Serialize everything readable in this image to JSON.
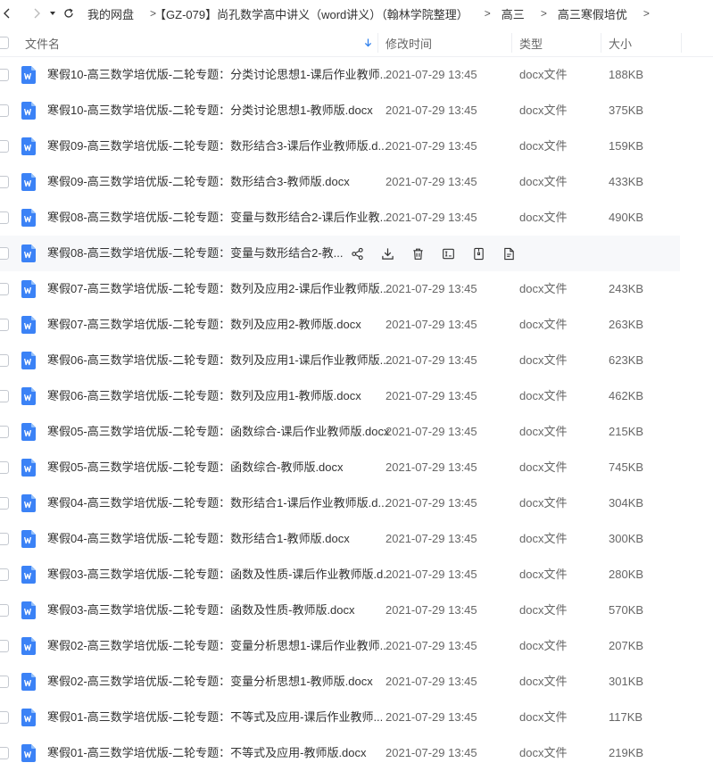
{
  "breadcrumb": [
    "我的网盘",
    "【GZ-079】尚孔数学高中讲义（word讲义）（翰林学院整理）",
    "高三",
    "高三寒假培优"
  ],
  "header": {
    "name": "文件名",
    "date": "修改时间",
    "type": "类型",
    "size": "大小"
  },
  "files": [
    {
      "name": "寒假10-高三数学培优版-二轮专题：分类讨论思想1-课后作业教师...",
      "date": "2021-07-29 13:45",
      "type": "docx文件",
      "size": "188KB"
    },
    {
      "name": "寒假10-高三数学培优版-二轮专题：分类讨论思想1-教师版.docx",
      "date": "2021-07-29 13:45",
      "type": "docx文件",
      "size": "375KB"
    },
    {
      "name": "寒假09-高三数学培优版-二轮专题：数形结合3-课后作业教师版.d...",
      "date": "2021-07-29 13:45",
      "type": "docx文件",
      "size": "159KB"
    },
    {
      "name": "寒假09-高三数学培优版-二轮专题：数形结合3-教师版.docx",
      "date": "2021-07-29 13:45",
      "type": "docx文件",
      "size": "433KB"
    },
    {
      "name": "寒假08-高三数学培优版-二轮专题：变量与数形结合2-课后作业教...",
      "date": "2021-07-29 13:45",
      "type": "docx文件",
      "size": "490KB"
    },
    {
      "name": "寒假08-高三数学培优版-二轮专题：变量与数形结合2-教...",
      "date": "",
      "type": "",
      "size": "",
      "hover": true
    },
    {
      "name": "寒假07-高三数学培优版-二轮专题：数列及应用2-课后作业教师版....",
      "date": "2021-07-29 13:45",
      "type": "docx文件",
      "size": "243KB"
    },
    {
      "name": "寒假07-高三数学培优版-二轮专题：数列及应用2-教师版.docx",
      "date": "2021-07-29 13:45",
      "type": "docx文件",
      "size": "263KB"
    },
    {
      "name": "寒假06-高三数学培优版-二轮专题：数列及应用1-课后作业教师版....",
      "date": "2021-07-29 13:45",
      "type": "docx文件",
      "size": "623KB"
    },
    {
      "name": "寒假06-高三数学培优版-二轮专题：数列及应用1-教师版.docx",
      "date": "2021-07-29 13:45",
      "type": "docx文件",
      "size": "462KB"
    },
    {
      "name": "寒假05-高三数学培优版-二轮专题：函数综合-课后作业教师版.docx",
      "date": "2021-07-29 13:45",
      "type": "docx文件",
      "size": "215KB"
    },
    {
      "name": "寒假05-高三数学培优版-二轮专题：函数综合-教师版.docx",
      "date": "2021-07-29 13:45",
      "type": "docx文件",
      "size": "745KB"
    },
    {
      "name": "寒假04-高三数学培优版-二轮专题：数形结合1-课后作业教师版.d...",
      "date": "2021-07-29 13:45",
      "type": "docx文件",
      "size": "304KB"
    },
    {
      "name": "寒假04-高三数学培优版-二轮专题：数形结合1-教师版.docx",
      "date": "2021-07-29 13:45",
      "type": "docx文件",
      "size": "300KB"
    },
    {
      "name": "寒假03-高三数学培优版-二轮专题：函数及性质-课后作业教师版.d...",
      "date": "2021-07-29 13:45",
      "type": "docx文件",
      "size": "280KB"
    },
    {
      "name": "寒假03-高三数学培优版-二轮专题：函数及性质-教师版.docx",
      "date": "2021-07-29 13:45",
      "type": "docx文件",
      "size": "570KB"
    },
    {
      "name": "寒假02-高三数学培优版-二轮专题：变量分析思想1-课后作业教师...",
      "date": "2021-07-29 13:45",
      "type": "docx文件",
      "size": "207KB"
    },
    {
      "name": "寒假02-高三数学培优版-二轮专题：变量分析思想1-教师版.docx",
      "date": "2021-07-29 13:45",
      "type": "docx文件",
      "size": "301KB"
    },
    {
      "name": "寒假01-高三数学培优版-二轮专题：不等式及应用-课后作业教师...",
      "date": "2021-07-29 13:45",
      "type": "docx文件",
      "size": "117KB"
    },
    {
      "name": "寒假01-高三数学培优版-二轮专题：不等式及应用-教师版.docx",
      "date": "2021-07-29 13:45",
      "type": "docx文件",
      "size": "219KB"
    }
  ],
  "colors": {
    "accent": "#2f80ed",
    "icon": "#3b82f6"
  }
}
